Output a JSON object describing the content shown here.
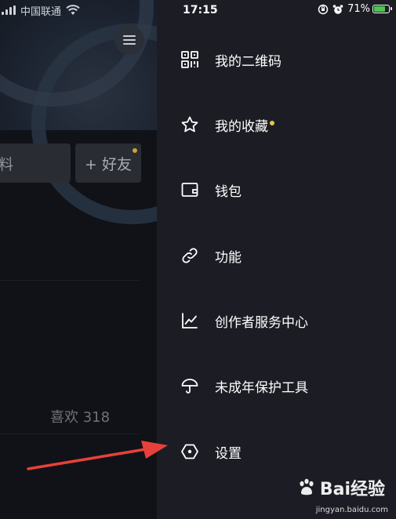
{
  "status_bar": {
    "carrier": "中国联通",
    "time": "17:15",
    "battery": "71%"
  },
  "left_panel": {
    "profile_button_label": "料",
    "add_friend_label": "+ 好友",
    "likes_label": "喜欢 318"
  },
  "drawer": {
    "items": [
      {
        "label": "我的二维码",
        "icon": "qrcode-icon"
      },
      {
        "label": "我的收藏",
        "icon": "star-icon",
        "badge": true
      },
      {
        "label": "钱包",
        "icon": "wallet-icon"
      },
      {
        "label": "功能",
        "icon": "link-icon"
      },
      {
        "label": "创作者服务中心",
        "icon": "chart-line-icon"
      },
      {
        "label": "未成年保护工具",
        "icon": "umbrella-icon"
      },
      {
        "label": "设置",
        "icon": "hexagon-settings-icon"
      }
    ]
  },
  "watermark": {
    "brand": "Bai经验",
    "url": "jingyan.baidu.com"
  },
  "colors": {
    "drawer_bg": "#1c1d24",
    "badge": "#e6c84a",
    "arrow": "#e8403a",
    "battery": "#49c94e"
  }
}
